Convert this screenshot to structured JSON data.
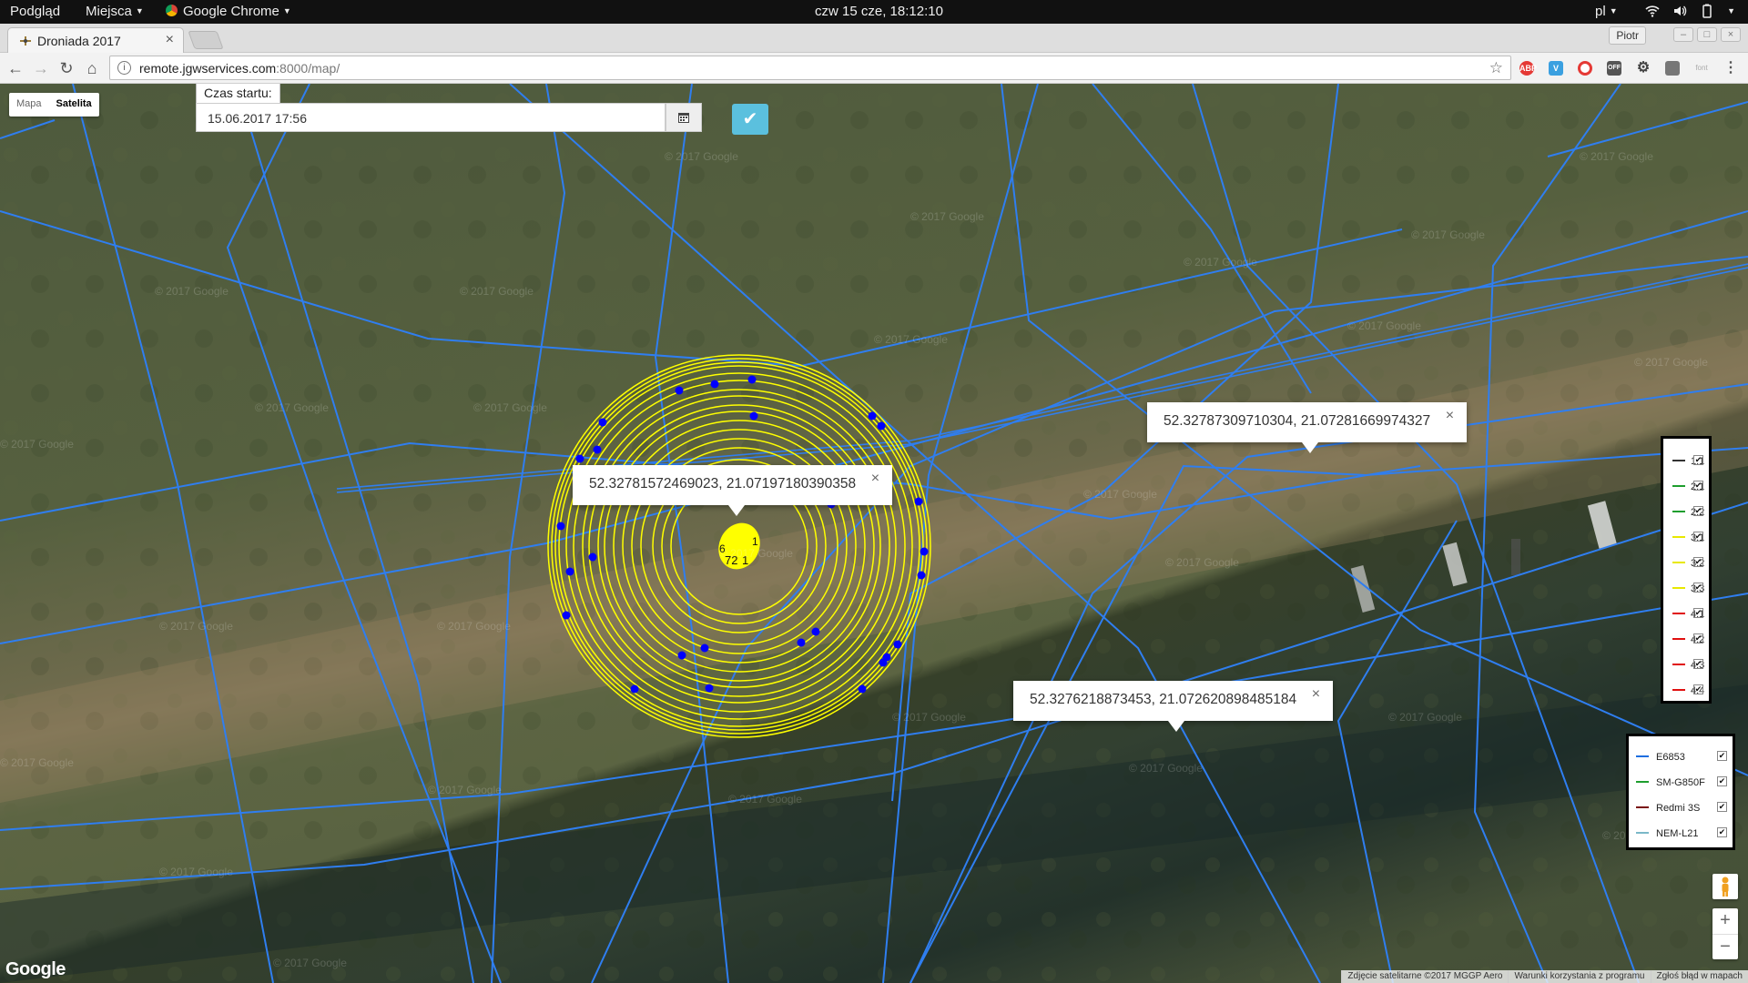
{
  "topbar": {
    "activities": "Podgląd",
    "places": "Miejsca",
    "app": "Google Chrome",
    "clock": "czw 15 cze, 18:12:10",
    "lang": "pl"
  },
  "browser": {
    "tab_title": "Droniada 2017",
    "profile": "Piotr",
    "url_host": "remote.jgwservices.com",
    "url_rest": ":8000/map/"
  },
  "map": {
    "maptype": {
      "map": "Mapa",
      "satellite": "Satelita",
      "selected": "Satelita"
    },
    "start": {
      "label": "Czas startu:",
      "value": "15.06.2017 17:56"
    },
    "cluster_labels": [
      "6",
      "72",
      "1",
      "1"
    ],
    "infowindows": [
      {
        "text": "52.32781572469023, 21.07197180390358"
      },
      {
        "text": "52.32787309710304, 21.07281669974327"
      },
      {
        "text": "52.3276218873453, 21.072620898485184"
      }
    ],
    "watermark": "© 2017 Google",
    "google_logo": "Google",
    "attribution": [
      "Zdjęcie satelitarne ©2017 MGGP Aero",
      "Warunki korzystania z programu",
      "Zgłoś błąd w mapach"
    ]
  },
  "legend_routes": [
    {
      "label": "1.1",
      "color": "#333333",
      "checked": true
    },
    {
      "label": "2.1",
      "color": "#1e9e2e",
      "checked": true
    },
    {
      "label": "2.2",
      "color": "#1e9e2e",
      "checked": true
    },
    {
      "label": "3.1",
      "color": "#e8e800",
      "checked": true
    },
    {
      "label": "3.2",
      "color": "#e8e800",
      "checked": true
    },
    {
      "label": "3.3",
      "color": "#e8e800",
      "checked": true
    },
    {
      "label": "4.1",
      "color": "#e01010",
      "checked": true
    },
    {
      "label": "4.2",
      "color": "#e01010",
      "checked": true
    },
    {
      "label": "4.3",
      "color": "#e01010",
      "checked": true
    },
    {
      "label": "4.4",
      "color": "#e01010",
      "checked": true
    }
  ],
  "legend_devices": [
    {
      "label": "E6853",
      "color": "#1e6ee0",
      "checked": true
    },
    {
      "label": "SM-G850F",
      "color": "#1e9e2e",
      "checked": true
    },
    {
      "label": "Redmi 3S",
      "color": "#7a1010",
      "checked": true
    },
    {
      "label": "NEM-L21",
      "color": "#7ab8c8",
      "checked": true
    }
  ],
  "colors": {
    "route_line": "#2f7ef0",
    "circles": "#ffff00",
    "waypoints": "#0000ff",
    "confirm": "#5bc0de"
  }
}
